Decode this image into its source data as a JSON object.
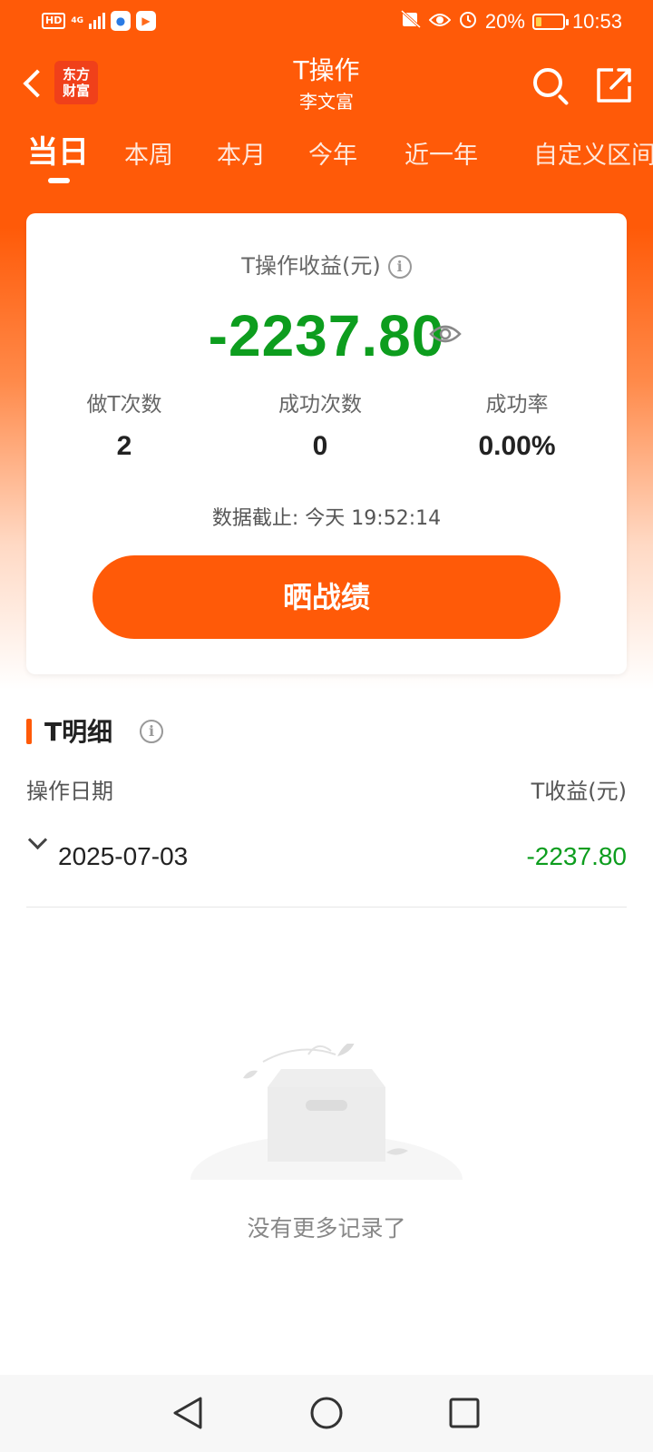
{
  "status_bar": {
    "hd": "HD",
    "network": "4G",
    "battery_percent": "20%",
    "battery_level": 0.2,
    "time": "10:53"
  },
  "header": {
    "brand_logo": "东方财富",
    "title": "T操作",
    "subtitle": "李文富"
  },
  "tabs": [
    {
      "label": "当日",
      "active": true
    },
    {
      "label": "本周",
      "active": false
    },
    {
      "label": "本月",
      "active": false
    },
    {
      "label": "今年",
      "active": false
    },
    {
      "label": "近一年",
      "active": false
    },
    {
      "label": "自定义区间",
      "active": false
    }
  ],
  "summary": {
    "label": "T操作收益(元)",
    "profit": "-2237.80",
    "stats": [
      {
        "label": "做T次数",
        "value": "2"
      },
      {
        "label": "成功次数",
        "value": "0"
      },
      {
        "label": "成功率",
        "value": "0.00%"
      }
    ],
    "data_time": "数据截止: 今天 19:52:14",
    "share_button": "晒战绩"
  },
  "detail": {
    "title": "T明细",
    "col_date": "操作日期",
    "col_profit": "T收益(元)",
    "rows": [
      {
        "date": "2025-07-03",
        "profit": "-2237.80"
      }
    ],
    "empty_text": "没有更多记录了"
  },
  "colors": {
    "brand_orange": "#ff5a08",
    "profit_green": "#0d9d1e"
  }
}
